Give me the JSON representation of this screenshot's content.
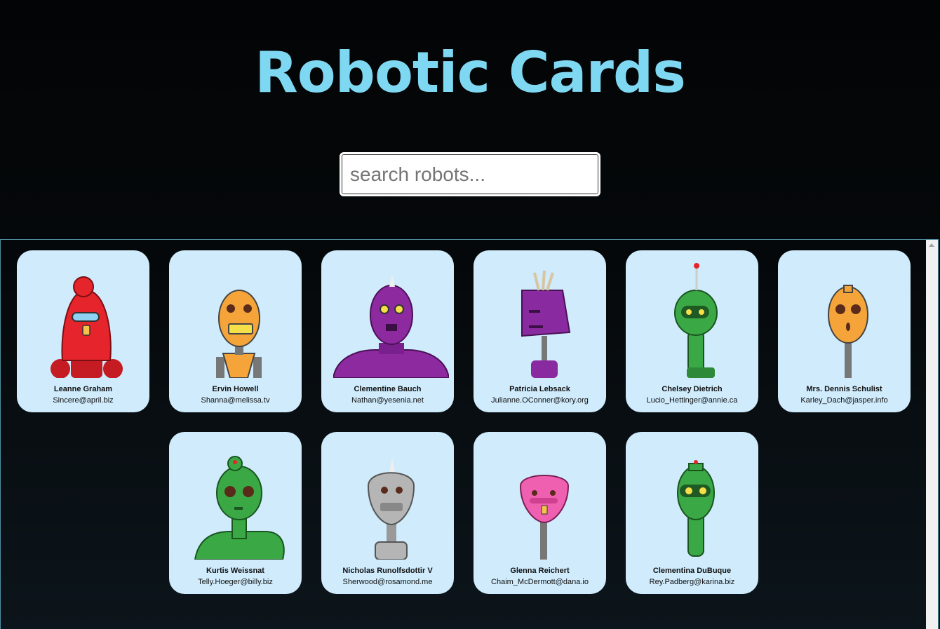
{
  "app": {
    "title": "Robotic Cards"
  },
  "search": {
    "placeholder": "search robots...",
    "value": ""
  },
  "robots": [
    {
      "name": "Leanne Graham",
      "email": "Sincere@april.biz",
      "color": "#e5252b"
    },
    {
      "name": "Ervin Howell",
      "email": "Shanna@melissa.tv",
      "color": "#f5a43a"
    },
    {
      "name": "Clementine Bauch",
      "email": "Nathan@yesenia.net",
      "color": "#8d2aa0"
    },
    {
      "name": "Patricia Lebsack",
      "email": "Julianne.OConner@kory.org",
      "color": "#8a2aa0"
    },
    {
      "name": "Chelsey Dietrich",
      "email": "Lucio_Hettinger@annie.ca",
      "color": "#3aa844"
    },
    {
      "name": "Mrs. Dennis Schulist",
      "email": "Karley_Dach@jasper.info",
      "color": "#f5a43a"
    },
    {
      "name": "Kurtis Weissnat",
      "email": "Telly.Hoeger@billy.biz",
      "color": "#3aa844"
    },
    {
      "name": "Nicholas Runolfsdottir V",
      "email": "Sherwood@rosamond.me",
      "color": "#b5b5b5"
    },
    {
      "name": "Glenna Reichert",
      "email": "Chaim_McDermott@dana.io",
      "color": "#f060b0"
    },
    {
      "name": "Clementina DuBuque",
      "email": "Rey.Padberg@karina.biz",
      "color": "#3aa844"
    }
  ]
}
